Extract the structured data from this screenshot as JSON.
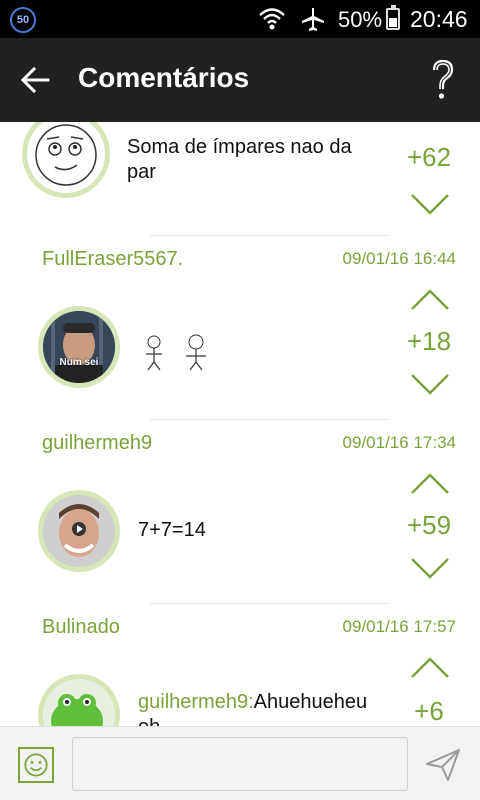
{
  "status_bar": {
    "notification_count": "50",
    "battery_percent": "50%",
    "time": "20:46"
  },
  "app_bar": {
    "title": "Comentários"
  },
  "comments": [
    {
      "author": "",
      "date": "",
      "text": "Soma de ímpares nao da par",
      "score": "+62"
    },
    {
      "author": "FullEraser5567.",
      "date": "09/01/16 16:44",
      "avatar_caption": "Num sei",
      "text": "",
      "score": "+18"
    },
    {
      "author": "guilhermeh9",
      "date": "09/01/16 17:34",
      "text": "7+7=14",
      "score": "+59"
    },
    {
      "author": "Bulinado",
      "date": "09/01/16 17:57",
      "mention": "guilhermeh9:",
      "text": "Ahuehueheu eh",
      "score": "+6"
    }
  ],
  "compose": {
    "placeholder": ""
  },
  "colors": {
    "accent": "#7ba33a",
    "app_bar": "#212121",
    "status_bar": "#000000"
  }
}
